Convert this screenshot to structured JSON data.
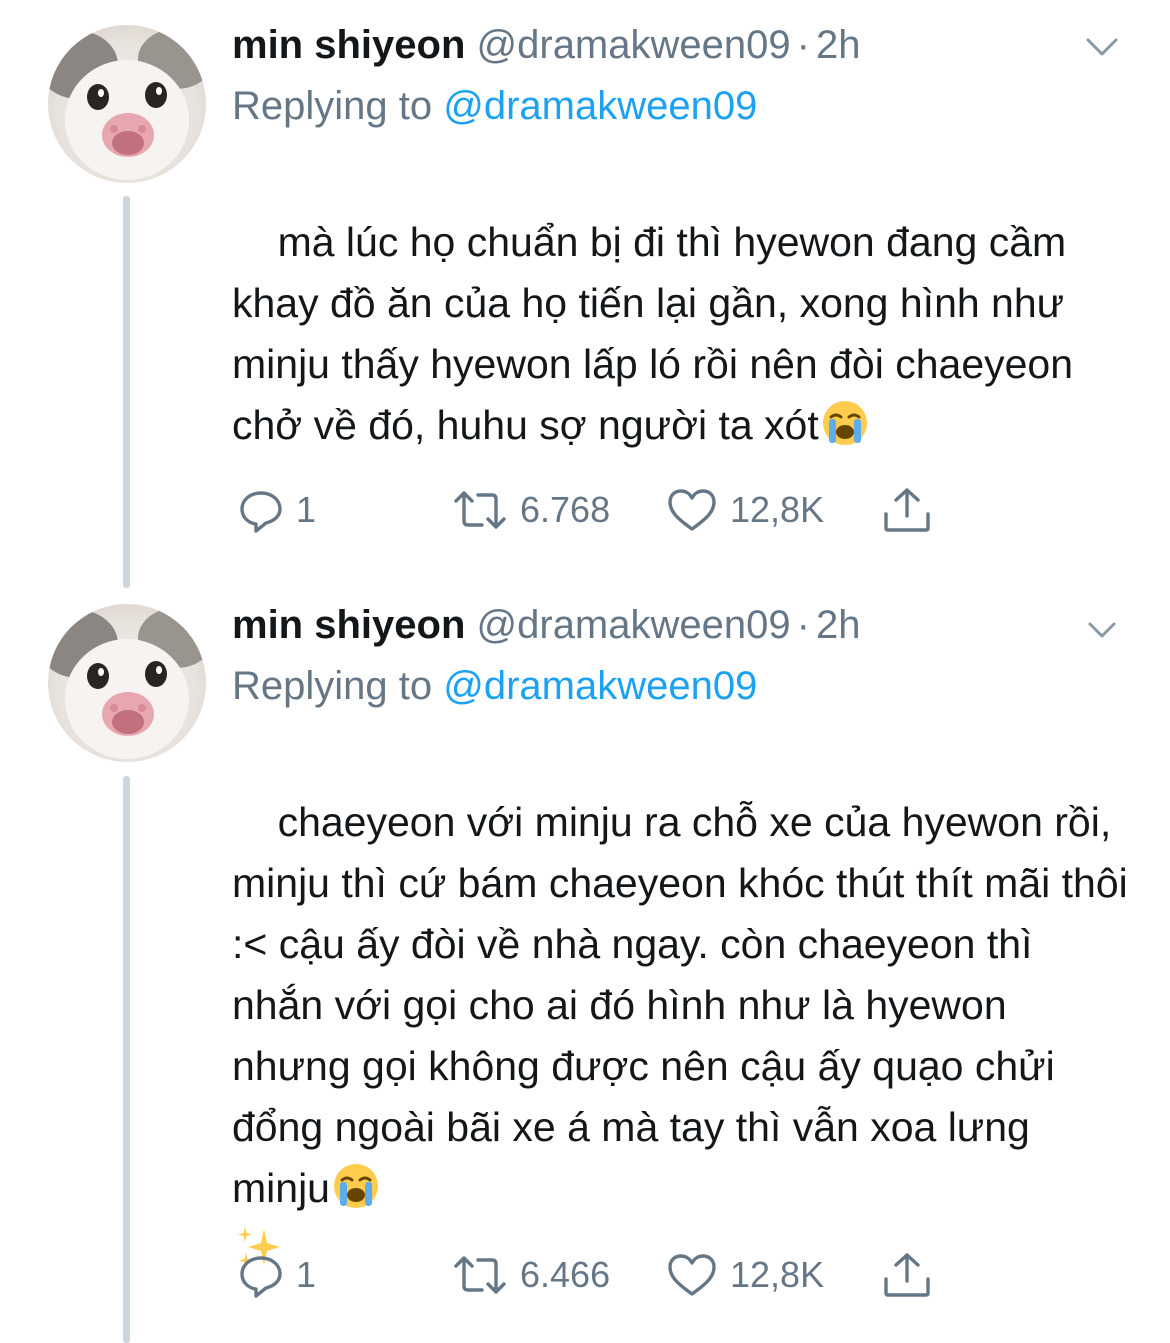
{
  "tweets": [
    {
      "display_name": "min shiyeon",
      "handle": "@dramakween09",
      "separator": "·",
      "time": "2h",
      "replying_prefix": "Replying to",
      "replying_to": "@dramakween09",
      "text_main": "mà lúc họ chuẩn bị đi thì hyewon đang cầm khay đồ ăn của họ tiến lại gần, xong hình như minju thấy hyewon lấp ló rồi nên đòi chaeyeon chở về đó, huhu sợ người ta xót",
      "emoji": "loudly-crying-face",
      "replies": "1",
      "retweets": "6.768",
      "likes": "12,8K"
    },
    {
      "display_name": "min shiyeon",
      "handle": "@dramakween09",
      "separator": "·",
      "time": "2h",
      "replying_prefix": "Replying to",
      "replying_to": "@dramakween09",
      "text_main": "chaeyeon với minju ra chỗ xe của hyewon rồi, minju thì cứ bám chaeyeon khóc thút thít mãi thôi :< cậu ấy đòi về nhà ngay. còn chaeyeon thì nhắn với gọi cho ai đó hình như là hyewon nhưng gọi không được nên cậu ấy quạo chửi đổng ngoài bãi xe á mà tay thì vẫn xoa lưng minju",
      "emoji": "loudly-crying-face",
      "emoji_2": "sparkles",
      "replies": "1",
      "retweets": "6.466",
      "likes": "12,8K"
    }
  ],
  "colors": {
    "text": "#14171a",
    "secondary": "#657786",
    "link": "#1da1f2",
    "thread_line": "#ccd6dd"
  },
  "icons": [
    "chevron-down-icon",
    "reply-icon",
    "retweet-icon",
    "like-icon",
    "share-icon"
  ]
}
